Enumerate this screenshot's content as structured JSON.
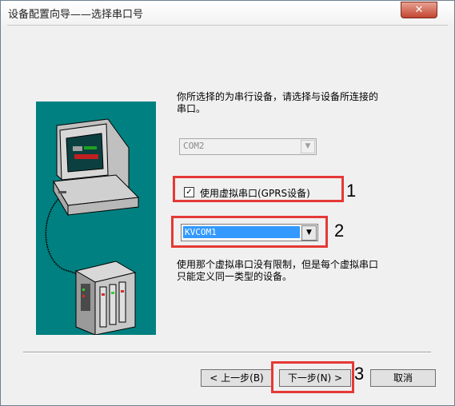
{
  "window": {
    "title": "设备配置向导——选择串口号",
    "close_glyph": "✕"
  },
  "main": {
    "description": "你所选择的为串行设备，请选择与设备所连接的串口。",
    "port_combo_value": "COM2",
    "virtual_checkbox_label": "使用虚拟串口(GPRS设备)",
    "virtual_checked": true,
    "check_glyph": "✓",
    "virtual_combo_value": "KVCOM1",
    "note": "使用那个虚拟串口没有限制，但是每个虚拟串口只能定义同一类型的设备。"
  },
  "buttons": {
    "back": "< 上一步(B)",
    "next": "下一步(N) >",
    "cancel": "取消"
  },
  "annotations": {
    "step1": "1",
    "step2": "2",
    "step3": "3",
    "color": "#e53935"
  },
  "icons": {
    "illustration": "computer-and-device-illustration",
    "combo_arrow": "▼"
  }
}
